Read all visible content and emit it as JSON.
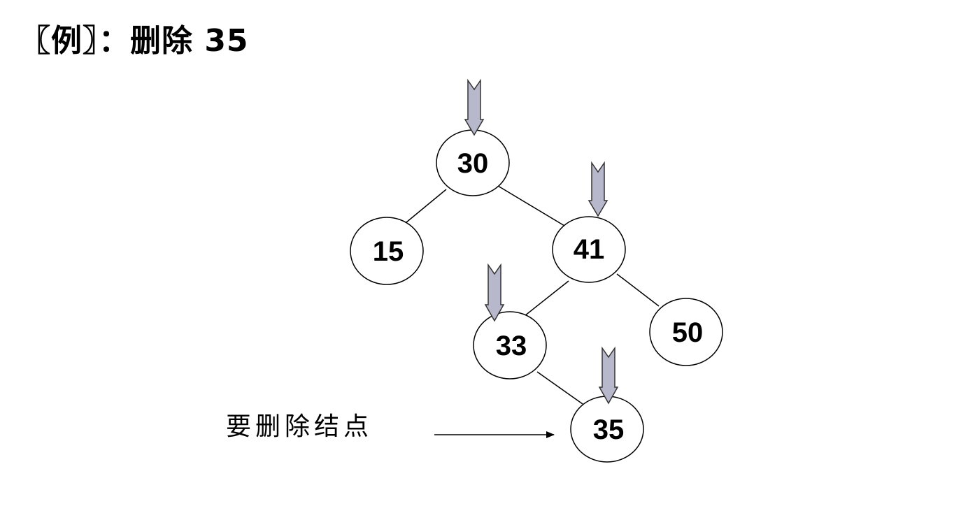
{
  "title": "〖例〗：删除 35",
  "caption": "要删除结点",
  "colors": {
    "stroke": "#000000",
    "node_fill": "#ffffff",
    "pointer_fill": "#b8b8cc",
    "pointer_stroke": "#333333"
  },
  "tree": {
    "nodes": [
      {
        "id": "n30",
        "label": "30"
      },
      {
        "id": "n15",
        "label": "15"
      },
      {
        "id": "n41",
        "label": "41"
      },
      {
        "id": "n33",
        "label": "33"
      },
      {
        "id": "n50",
        "label": "50"
      },
      {
        "id": "n35",
        "label": "35"
      }
    ],
    "edges": [
      [
        "n30",
        "n15"
      ],
      [
        "n30",
        "n41"
      ],
      [
        "n41",
        "n33"
      ],
      [
        "n41",
        "n50"
      ],
      [
        "n33",
        "n35"
      ]
    ],
    "search_path": [
      "n30",
      "n41",
      "n33",
      "n35"
    ],
    "target": "n35"
  }
}
